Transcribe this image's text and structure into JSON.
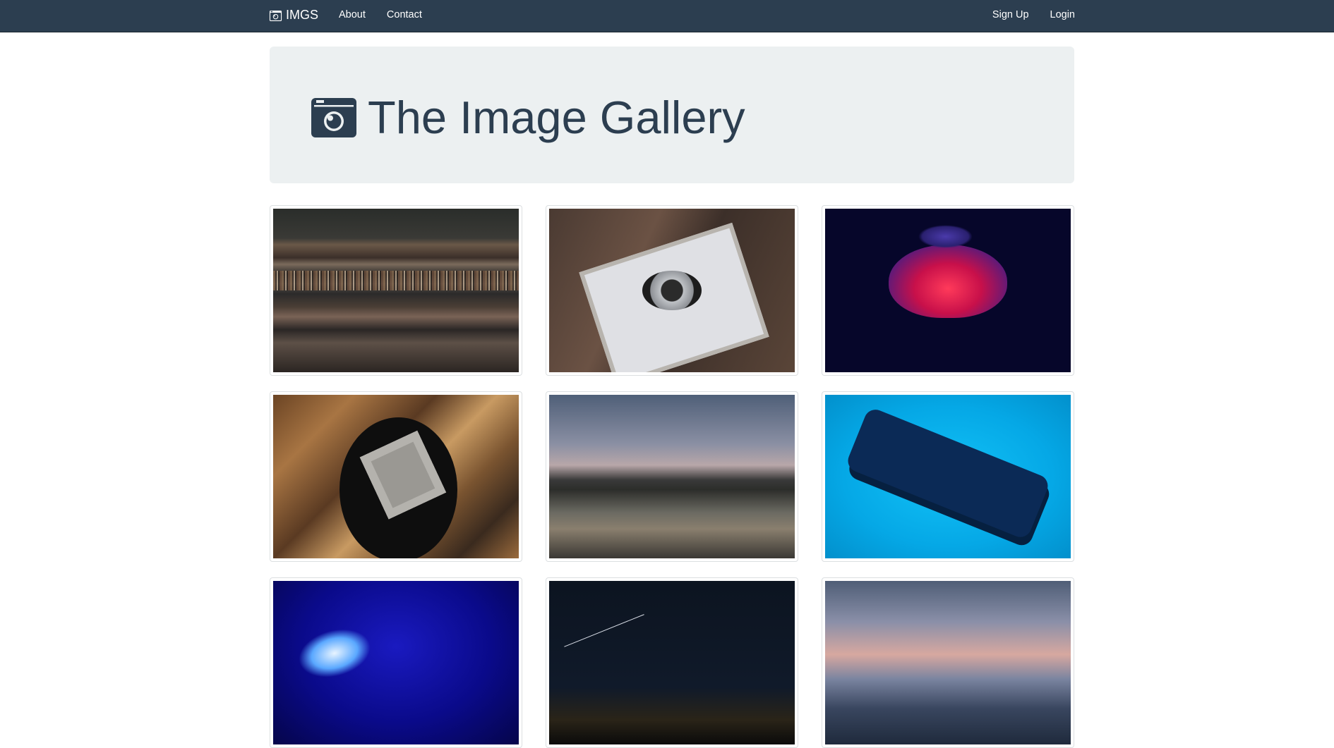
{
  "navbar": {
    "brand": "IMGS",
    "brand_icon": "camera-icon",
    "links": [
      "About",
      "Contact"
    ],
    "right_links": [
      "Sign Up",
      "Login"
    ],
    "background": "#2c3e50"
  },
  "jumbotron": {
    "title": "The Image Gallery",
    "icon": "camera-icon",
    "background": "#ecf0f1"
  },
  "gallery": {
    "images": [
      {
        "subject": "bookshelf"
      },
      {
        "subject": "camera"
      },
      {
        "subject": "jellyfish"
      },
      {
        "subject": "plate"
      },
      {
        "subject": "lake"
      },
      {
        "subject": "phone"
      },
      {
        "subject": "jellyfish"
      },
      {
        "subject": "stars"
      },
      {
        "subject": "sea"
      }
    ]
  }
}
